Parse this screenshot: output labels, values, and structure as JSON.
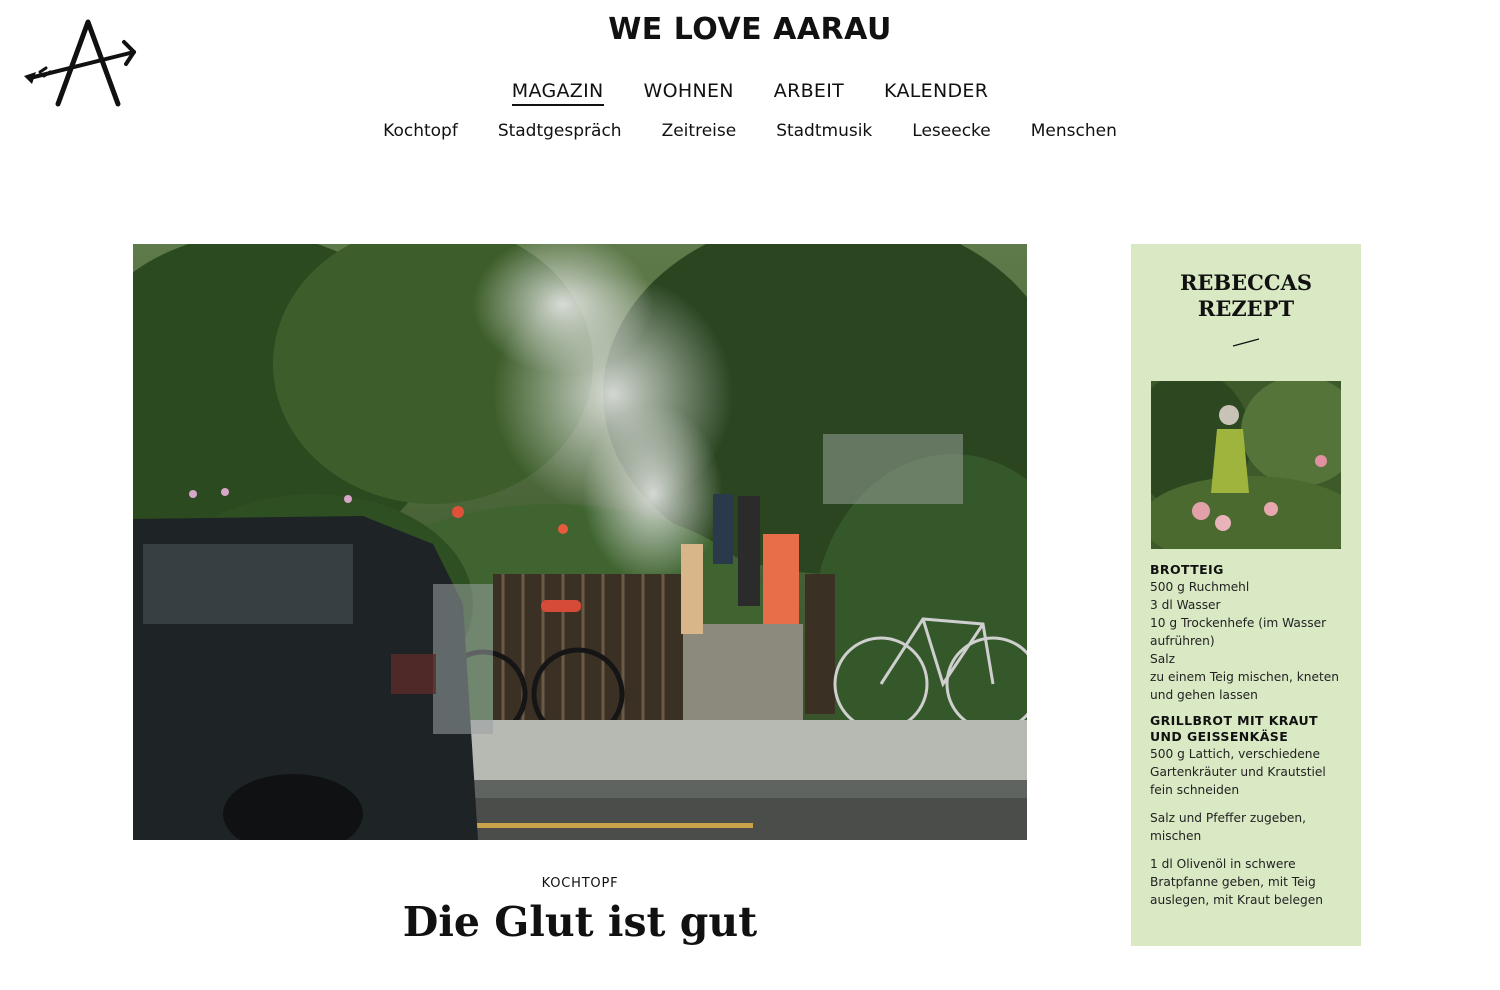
{
  "header": {
    "site_title": "WE LOVE AARAU",
    "logo_icon": "arrow-a-logo-icon"
  },
  "main_nav": [
    {
      "label": "MAGAZIN",
      "active": true
    },
    {
      "label": "WOHNEN",
      "active": false
    },
    {
      "label": "ARBEIT",
      "active": false
    },
    {
      "label": "KALENDER",
      "active": false
    }
  ],
  "sub_nav": [
    "Kochtopf",
    "Stadtgespräch",
    "Zeitreise",
    "Stadtmusik",
    "Leseecke",
    "Menschen"
  ],
  "article": {
    "category": "KOCHTOPF",
    "headline": "Die Glut ist gut"
  },
  "recipe": {
    "title_line1": "REBECCAS",
    "title_line2": "REZEPT",
    "section1": {
      "heading": "BROTTEIG",
      "lines": [
        "500 g Ruchmehl",
        "3 dl Wasser",
        "10 g Trockenhefe (im Wasser aufrühren)",
        "Salz",
        "zu einem Teig mischen, kneten und gehen lassen"
      ]
    },
    "section2": {
      "heading": "GRILLBROT MIT KRAUT UND GEISSENKÄSE",
      "paragraphs": [
        "500 g Lattich, verschiedene Gartenkräuter und Krautstiel fein schneiden",
        "Salz und Pfeffer zugeben, mischen",
        "1 dl Olivenöl in schwere Bratpfanne geben, mit Teig auslegen, mit Kraut belegen"
      ]
    }
  },
  "colors": {
    "recipe_bg": "#d9e9c4",
    "text": "#111111"
  }
}
